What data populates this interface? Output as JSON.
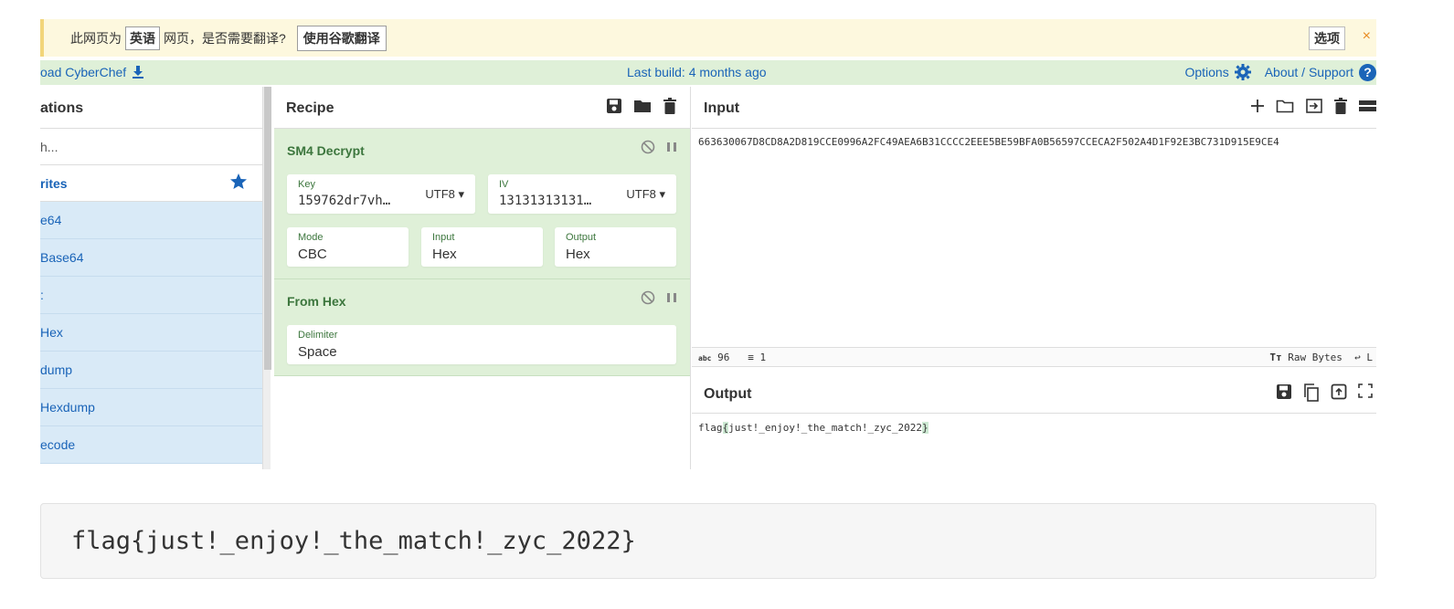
{
  "translate_bar": {
    "message_prefix": "此网页为",
    "language": "英语",
    "message_suffix": "网页，是否需要翻译?",
    "translate_button": "使用谷歌翻译",
    "options_button": "选项",
    "close": "×"
  },
  "banner": {
    "download_label": "oad CyberChef",
    "last_build": "Last build: 4 months ago",
    "options_label": "Options",
    "about_label": "About / Support",
    "help_glyph": "?"
  },
  "operations": {
    "title": "ations",
    "search_placeholder": "h...",
    "favourites_label": "rites",
    "items": [
      "e64",
      "Base64",
      ":",
      "Hex",
      "dump",
      "Hexdump",
      "ecode"
    ]
  },
  "recipe": {
    "title": "Recipe",
    "operations": [
      {
        "name": "SM4 Decrypt",
        "key_label": "Key",
        "key_value": "159762dr7vh…",
        "key_encoding": "UTF8 ▾",
        "iv_label": "IV",
        "iv_value": "13131313131…",
        "iv_encoding": "UTF8 ▾",
        "mode_label": "Mode",
        "mode_value": "CBC",
        "input_label": "Input",
        "input_value": "Hex",
        "output_label": "Output",
        "output_value": "Hex"
      },
      {
        "name": "From Hex",
        "delimiter_label": "Delimiter",
        "delimiter_value": "Space"
      }
    ]
  },
  "input": {
    "title": "Input",
    "value": "663630067D8CD8A2D819CCE0996A2FC49AEA6B31CCCC2EEE5BE59BFA0B56597CCECA2F502A4D1F92E3BC731D915E9CE4",
    "length_label": "96",
    "lines_label": "1",
    "raw_bytes_label": "Raw Bytes",
    "eol_label": "L"
  },
  "output": {
    "title": "Output",
    "value_prefix": "flag",
    "value_open": "{",
    "value_body": "just!_enjoy!_the_match!_zyc_2022",
    "value_close": "}"
  },
  "result_text": "flag{just!_enjoy!_the_match!_zyc_2022}",
  "colors": {
    "banner_bg": "#dff0d8",
    "link_blue": "#1a64b8",
    "op_green": "#3c763d",
    "ops_item_bg": "#d9eaf7",
    "translate_bg": "#fdf8de"
  }
}
